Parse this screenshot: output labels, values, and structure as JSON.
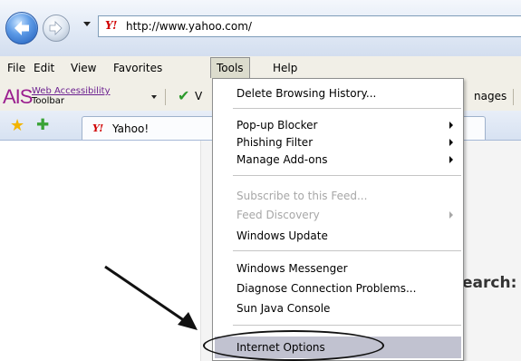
{
  "browser": {
    "address": "http://www.yahoo.com/",
    "site_logo": "Y!"
  },
  "menubar": {
    "file": "File",
    "edit": "Edit",
    "view": "View",
    "favorites": "Favorites",
    "tools": "Tools",
    "help": "Help"
  },
  "ais_toolbar": {
    "logo": "AIS",
    "line1": "Web Accessibility",
    "line2": "Toolbar",
    "v_text": "V",
    "images_text": "nages"
  },
  "tabs": [
    {
      "logo": "Y!",
      "label": "Yahoo!"
    }
  ],
  "page": {
    "search_fragment": "earch:"
  },
  "tools_menu": {
    "items": [
      {
        "label": "Delete Browsing History...",
        "enabled": true,
        "submenu": false
      },
      {
        "label": "Pop-up Blocker",
        "enabled": true,
        "submenu": true
      },
      {
        "label": "Phishing Filter",
        "enabled": true,
        "submenu": true
      },
      {
        "label": "Manage Add-ons",
        "enabled": true,
        "submenu": true
      },
      {
        "label": "Subscribe to this Feed...",
        "enabled": false,
        "submenu": false
      },
      {
        "label": "Feed Discovery",
        "enabled": false,
        "submenu": true
      },
      {
        "label": "Windows Update",
        "enabled": true,
        "submenu": false
      },
      {
        "label": "Windows Messenger",
        "enabled": true,
        "submenu": false
      },
      {
        "label": "Diagnose Connection Problems...",
        "enabled": true,
        "submenu": false
      },
      {
        "label": "Sun Java Console",
        "enabled": true,
        "submenu": false
      },
      {
        "label": "Internet Options",
        "enabled": true,
        "submenu": false,
        "highlighted": true
      }
    ]
  },
  "colors": {
    "highlight": "#c1c2d0",
    "ais_logo": "#9b1f8f",
    "yahoo_logo": "#d00000"
  }
}
